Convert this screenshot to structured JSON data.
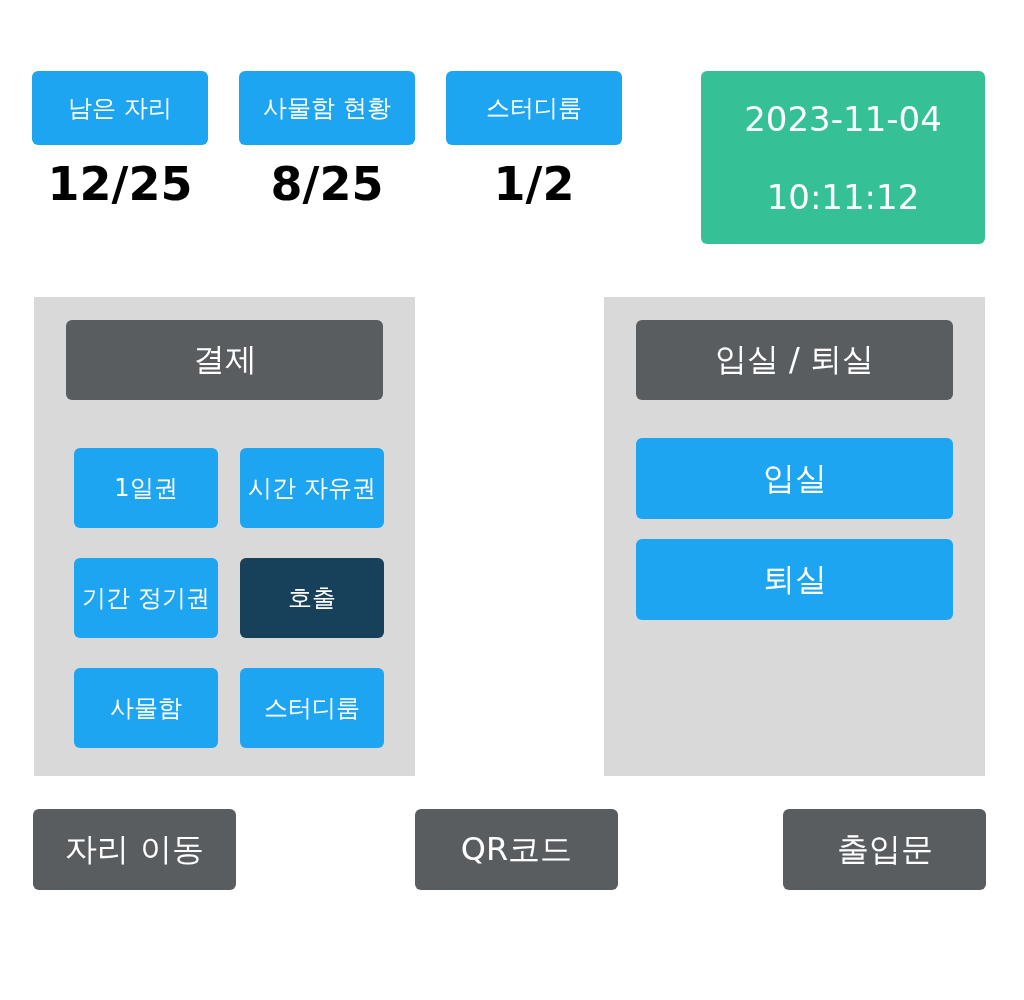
{
  "stats": [
    {
      "label": "남은 자리",
      "value": "12/25"
    },
    {
      "label": "사물함 현황",
      "value": "8/25"
    },
    {
      "label": "스터디룸",
      "value": "1/2"
    }
  ],
  "clock": {
    "date": "2023-11-04",
    "time": "10:11:12"
  },
  "payment_panel": {
    "title": "결제",
    "options": [
      {
        "label": "1일권",
        "selected": false
      },
      {
        "label": "시간 자유권",
        "selected": false
      },
      {
        "label": "기간 정기권",
        "selected": false
      },
      {
        "label": "호출",
        "selected": true
      },
      {
        "label": "사물함",
        "selected": false
      },
      {
        "label": "스터디룸",
        "selected": false
      }
    ]
  },
  "entry_panel": {
    "title": "입실 / 퇴실",
    "actions": [
      "입실",
      "퇴실"
    ]
  },
  "bottom_buttons": [
    "자리 이동",
    "QR코드",
    "출입문"
  ]
}
